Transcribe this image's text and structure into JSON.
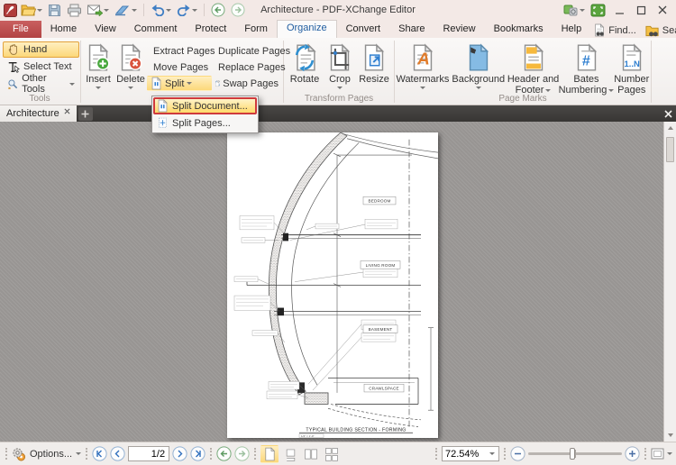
{
  "window": {
    "title": "Architecture - PDF-XChange Editor"
  },
  "tabs": {
    "items": [
      "File",
      "Home",
      "View",
      "Comment",
      "Protect",
      "Form",
      "Organize",
      "Convert",
      "Share",
      "Review",
      "Bookmarks",
      "Help"
    ],
    "active": "Organize",
    "find": "Find...",
    "search": "Search..."
  },
  "ribbon": {
    "tools": {
      "label": "Tools",
      "hand": "Hand",
      "select_text": "Select Text",
      "other_tools": "Other Tools"
    },
    "pages": {
      "insert": "Insert",
      "delete": "Delete",
      "extract": "Extract Pages",
      "move": "Move Pages",
      "split": "Split",
      "duplicate": "Duplicate Pages",
      "replace": "Replace Pages",
      "swap": "Swap Pages"
    },
    "transform": {
      "label": "Transform Pages",
      "rotate": "Rotate",
      "crop": "Crop",
      "resize": "Resize"
    },
    "marks": {
      "label": "Page Marks",
      "watermarks": "Watermarks",
      "background": "Background",
      "header_footer_1": "Header and",
      "header_footer_2": "Footer",
      "bates_1": "Bates",
      "bates_2": "Numbering",
      "number_1": "Number",
      "number_2": "Pages"
    }
  },
  "split_menu": {
    "split_document": "Split Document...",
    "split_pages": "Split Pages..."
  },
  "doc_tab": {
    "title": "Architecture"
  },
  "statusbar": {
    "options": "Options...",
    "page_value": "1/2",
    "zoom_value": "72.54%"
  },
  "drawing": {
    "rooms": [
      "BEDROOM",
      "LIVING ROOM",
      "BASEMENT",
      "CRAWLSPACE"
    ],
    "title": "TYPICAL BUILDING SECTION - FORMING",
    "scale": "1/4\" = 1'-0\""
  },
  "colors": {
    "accent_red": "#b24343",
    "selected_tab_blue": "#1f5da0",
    "highlight_yellow": "#fcd87a",
    "menu_border_red": "#cf3a3c"
  }
}
